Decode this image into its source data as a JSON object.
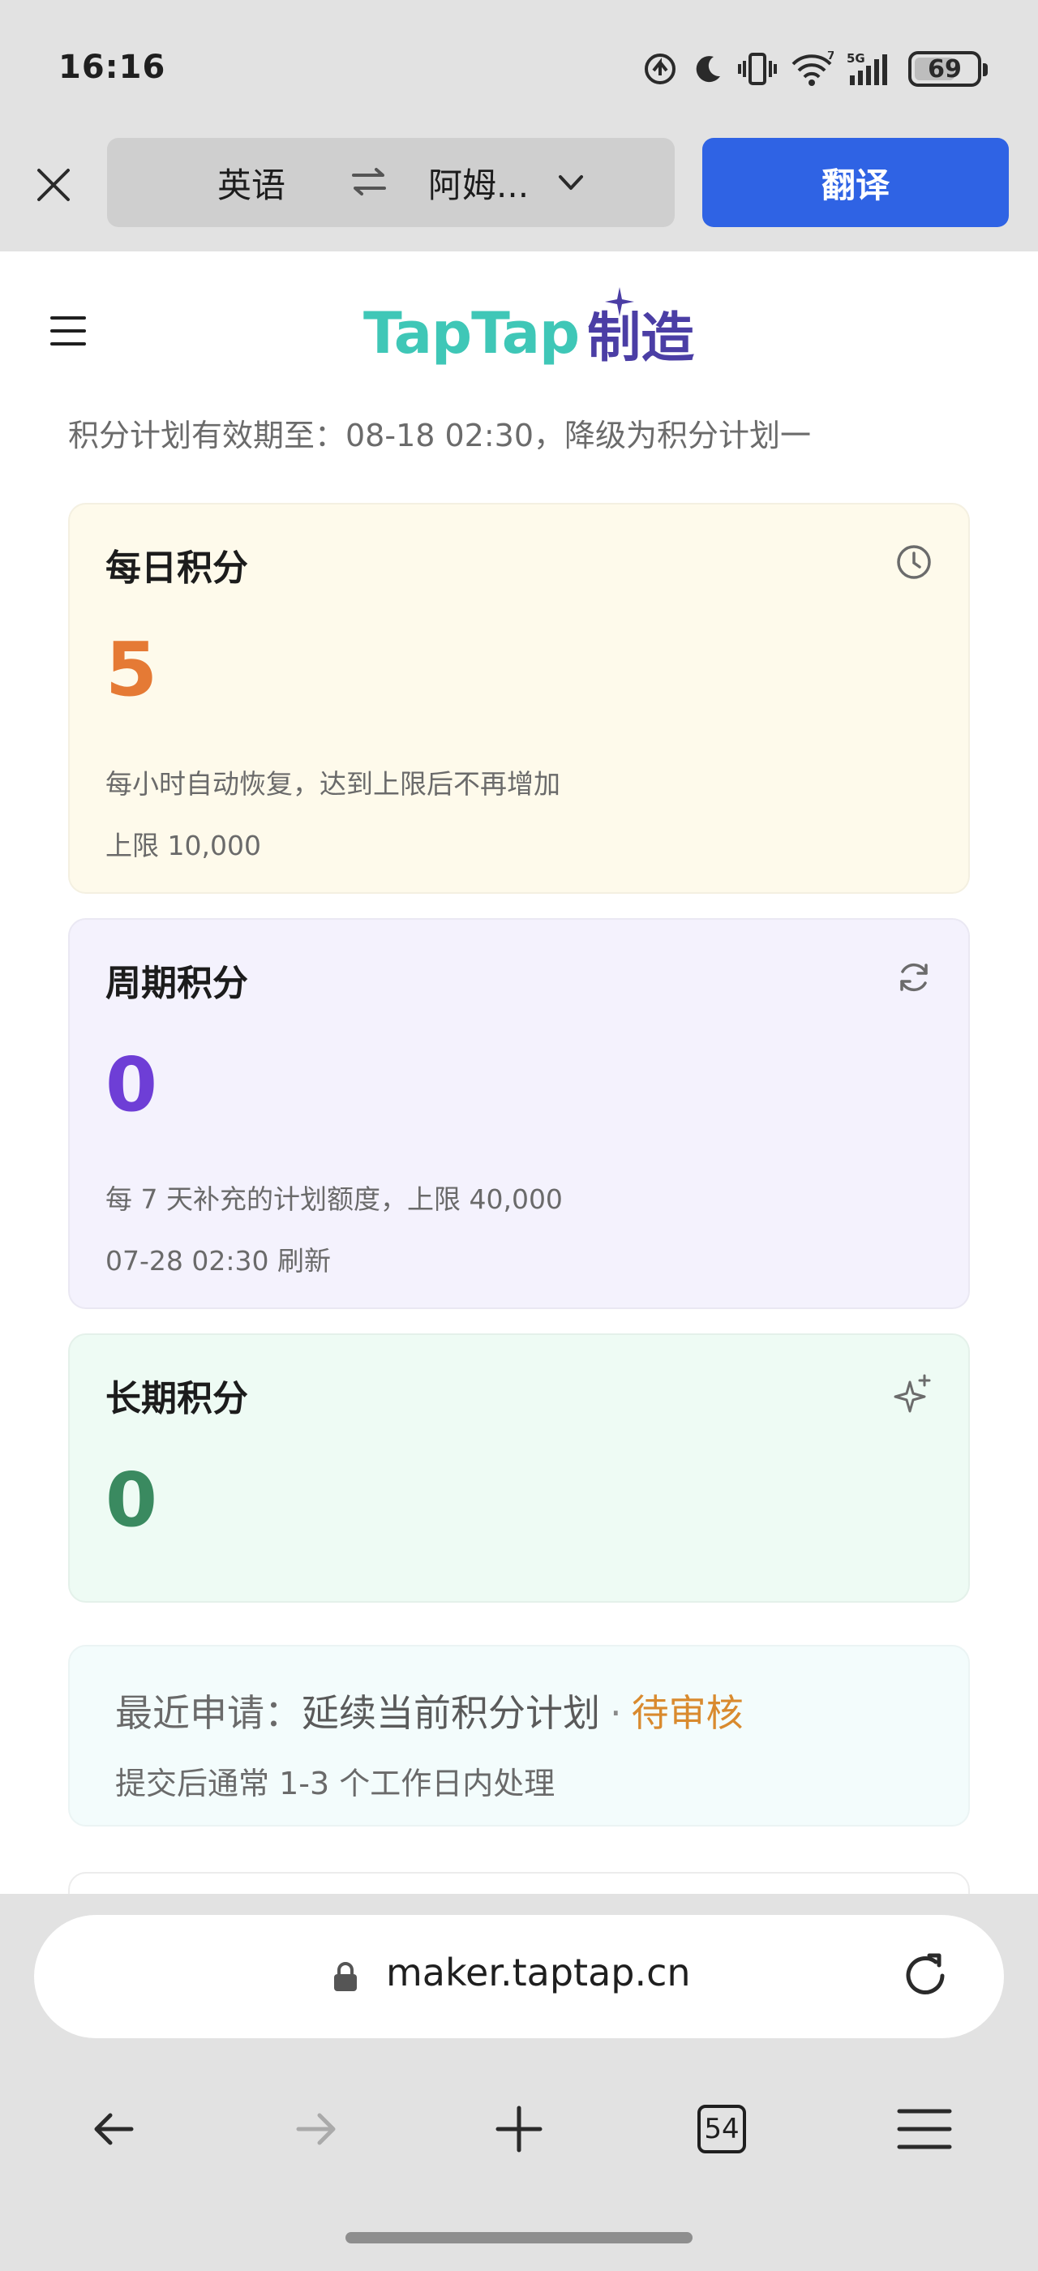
{
  "status_bar": {
    "time": "16:16",
    "battery": "69",
    "battery_level": 69,
    "network_label": "5G",
    "wifi_label": "7",
    "icons": [
      "data-saver-icon",
      "moon-icon",
      "vibrate-icon",
      "wifi-icon",
      "signal-icon",
      "battery-icon"
    ]
  },
  "translate_bar": {
    "source_lang": "英语",
    "target_lang": "阿姆...",
    "translate_label": "翻译",
    "icons": [
      "close-icon",
      "swap-icon",
      "chevron-down-icon"
    ]
  },
  "page": {
    "logo_latin": "TapTap",
    "logo_cn": "制造",
    "notice": "积分计划有效期至：08-18 02:30，降级为积分计划一",
    "cards": [
      {
        "title": "每日积分",
        "value": "5",
        "description": "每小时自动恢复，达到上限后不再增加",
        "sub": "上限 10,000",
        "icon": "clock-icon",
        "color": "#e57a35"
      },
      {
        "title": "周期积分",
        "value": "0",
        "description": "每 7 天补充的计划额度，上限 40,000",
        "sub": "07-28 02:30 刷新",
        "icon": "refresh-icon",
        "color": "#6e3ed6"
      },
      {
        "title": "长期积分",
        "value": "0",
        "icon": "sparkle-icon",
        "color": "#3a8a60"
      }
    ],
    "application": {
      "label": "最近申请：",
      "plan": "延续当前积分计划",
      "separator": "·",
      "status": "待审核",
      "note": "提交后通常 1-3 个工作日内处理"
    }
  },
  "browser": {
    "url": "maker.taptap.cn",
    "tab_count": "54",
    "icons": [
      "lock-icon",
      "reload-icon",
      "back-arrow-icon",
      "forward-arrow-icon",
      "plus-icon",
      "tabs-icon",
      "menu-icon"
    ]
  },
  "colors": {
    "translate_button": "#2f63e4",
    "logo_latin": "#3fc7b7",
    "logo_cn": "#4b3ea5",
    "pending": "#d98a2e"
  }
}
